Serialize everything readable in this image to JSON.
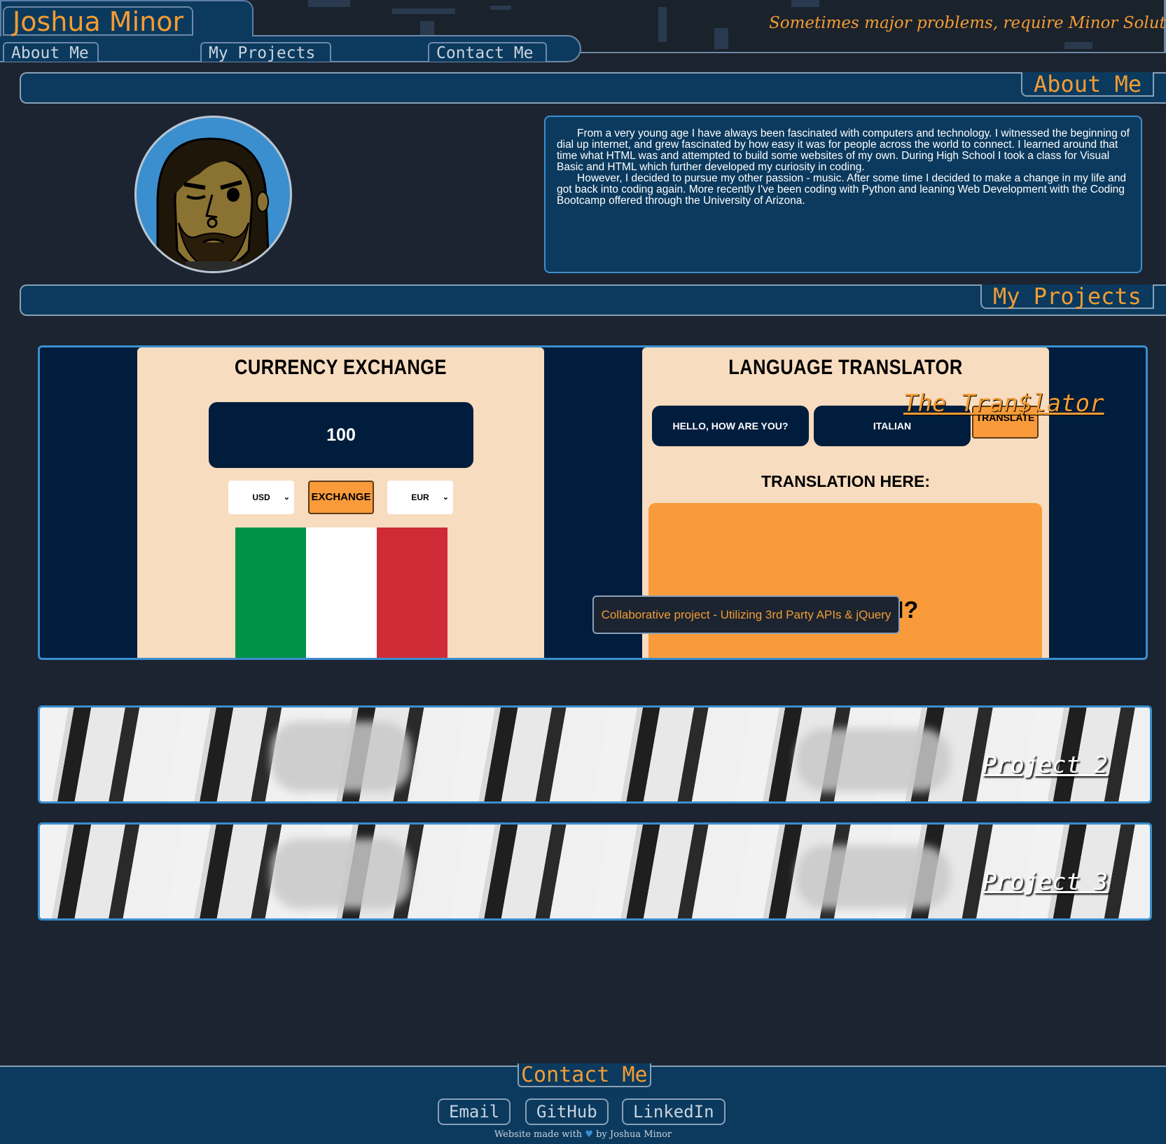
{
  "header": {
    "name": "Joshua Minor",
    "slogan": "Sometimes major problems, require Minor Solutions...",
    "nav": [
      "About Me",
      "My Projects",
      "Contact Me"
    ]
  },
  "about": {
    "section_title": "About Me",
    "bio_paragraphs": [
      "From a very young age I have always been fascinated with computers and technology. I witnessed the beginning of dial up internet, and grew fascinated by how easy it was for people across the world to connect. I learned around that time what HTML was and attempted to build some websites of my own. During High School I took a class for Visual Basic and HTML which further developed my curiosity in coding.",
      "However, I decided to pursue my other passion - music. After some time I decided to make a change in my life and got back into coding again. More recently I've been coding with Python and leaning Web Development with the Coding Bootcamp offered through the University of Arizona."
    ]
  },
  "projects": {
    "section_title": "My Projects",
    "project1": {
      "link_text": "The Tran$lator",
      "tooltip": "Collaborative project - Utilizing 3rd Party APIs & jQuery",
      "currency": {
        "title": "CURRENCY EXCHANGE",
        "amount": "100",
        "from": "USD",
        "button": "EXCHANGE",
        "to": "EUR"
      },
      "translator": {
        "title": "LANGUAGE TRANSLATOR",
        "phrase": "HELLO, HOW ARE YOU?",
        "language": "ITALIAN",
        "button": "TRANSLATE",
        "result_label": "TRANSLATION HERE:",
        "result_partial": "I?"
      }
    },
    "project2": {
      "link_text": "Project 2"
    },
    "project3": {
      "link_text": "Project 3"
    }
  },
  "footer": {
    "section_title": "Contact Me",
    "links": [
      "Email",
      "GitHub",
      "LinkedIn"
    ],
    "note_prefix": "Website made with",
    "note_suffix": "by Joshua Minor"
  },
  "colors": {
    "accent": "#f39c33",
    "navy": "#0b3a5e",
    "background": "#1b2430",
    "border_blue": "#3b8fcf",
    "peach": "#f8dcbf",
    "flag_green": "#009246",
    "flag_white": "#ffffff",
    "flag_red": "#ce2b37"
  }
}
